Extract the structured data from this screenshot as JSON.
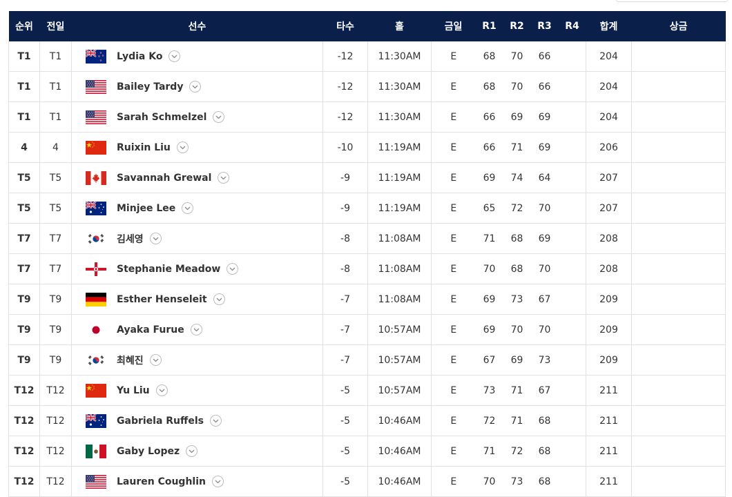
{
  "header": {
    "rank": "순위",
    "prev": "전일",
    "player": "선수",
    "score": "타수",
    "hole": "홀",
    "today": "금일",
    "r1": "R1",
    "r2": "R2",
    "r3": "R3",
    "r4": "R4",
    "total": "합계",
    "prize": "상금"
  },
  "rows": [
    {
      "pos": "T1",
      "prev": "T1",
      "flag": "nz-flag-icon",
      "name": "Lydia Ko",
      "score": "-12",
      "hole": "11:30AM",
      "today": "E",
      "r1": "68",
      "r2": "70",
      "r3": "66",
      "r4": "",
      "total": "204",
      "prize": ""
    },
    {
      "pos": "T1",
      "prev": "T1",
      "flag": "us-flag-icon",
      "name": "Bailey Tardy",
      "score": "-12",
      "hole": "11:30AM",
      "today": "E",
      "r1": "68",
      "r2": "70",
      "r3": "66",
      "r4": "",
      "total": "204",
      "prize": ""
    },
    {
      "pos": "T1",
      "prev": "T1",
      "flag": "us-flag-icon",
      "name": "Sarah Schmelzel",
      "score": "-12",
      "hole": "11:30AM",
      "today": "E",
      "r1": "66",
      "r2": "69",
      "r3": "69",
      "r4": "",
      "total": "204",
      "prize": ""
    },
    {
      "pos": "4",
      "prev": "4",
      "flag": "cn-flag-icon",
      "name": "Ruixin Liu",
      "score": "-10",
      "hole": "11:19AM",
      "today": "E",
      "r1": "66",
      "r2": "71",
      "r3": "69",
      "r4": "",
      "total": "206",
      "prize": ""
    },
    {
      "pos": "T5",
      "prev": "T5",
      "flag": "ca-flag-icon",
      "name": "Savannah Grewal",
      "score": "-9",
      "hole": "11:19AM",
      "today": "E",
      "r1": "69",
      "r2": "74",
      "r3": "64",
      "r4": "",
      "total": "207",
      "prize": ""
    },
    {
      "pos": "T5",
      "prev": "T5",
      "flag": "au-flag-icon",
      "name": "Minjee Lee",
      "score": "-9",
      "hole": "11:19AM",
      "today": "E",
      "r1": "65",
      "r2": "72",
      "r3": "70",
      "r4": "",
      "total": "207",
      "prize": ""
    },
    {
      "pos": "T7",
      "prev": "T7",
      "flag": "kr-flag-icon",
      "name": "김세영",
      "score": "-8",
      "hole": "11:08AM",
      "today": "E",
      "r1": "71",
      "r2": "68",
      "r3": "69",
      "r4": "",
      "total": "208",
      "prize": ""
    },
    {
      "pos": "T7",
      "prev": "T7",
      "flag": "nir-flag-icon",
      "name": "Stephanie Meadow",
      "score": "-8",
      "hole": "11:08AM",
      "today": "E",
      "r1": "70",
      "r2": "68",
      "r3": "70",
      "r4": "",
      "total": "208",
      "prize": ""
    },
    {
      "pos": "T9",
      "prev": "T9",
      "flag": "de-flag-icon",
      "name": "Esther Henseleit",
      "score": "-7",
      "hole": "11:08AM",
      "today": "E",
      "r1": "69",
      "r2": "73",
      "r3": "67",
      "r4": "",
      "total": "209",
      "prize": ""
    },
    {
      "pos": "T9",
      "prev": "T9",
      "flag": "jp-flag-icon",
      "name": "Ayaka Furue",
      "score": "-7",
      "hole": "10:57AM",
      "today": "E",
      "r1": "69",
      "r2": "70",
      "r3": "70",
      "r4": "",
      "total": "209",
      "prize": ""
    },
    {
      "pos": "T9",
      "prev": "T9",
      "flag": "kr-flag-icon",
      "name": "최혜진",
      "score": "-7",
      "hole": "10:57AM",
      "today": "E",
      "r1": "67",
      "r2": "69",
      "r3": "73",
      "r4": "",
      "total": "209",
      "prize": ""
    },
    {
      "pos": "T12",
      "prev": "T12",
      "flag": "cn-flag-icon",
      "name": "Yu Liu",
      "score": "-5",
      "hole": "10:57AM",
      "today": "E",
      "r1": "73",
      "r2": "71",
      "r3": "67",
      "r4": "",
      "total": "211",
      "prize": ""
    },
    {
      "pos": "T12",
      "prev": "T12",
      "flag": "au-flag-icon",
      "name": "Gabriela Ruffels",
      "score": "-5",
      "hole": "10:46AM",
      "today": "E",
      "r1": "72",
      "r2": "71",
      "r3": "68",
      "r4": "",
      "total": "211",
      "prize": ""
    },
    {
      "pos": "T12",
      "prev": "T12",
      "flag": "mx-flag-icon",
      "name": "Gaby Lopez",
      "score": "-5",
      "hole": "10:46AM",
      "today": "E",
      "r1": "71",
      "r2": "72",
      "r3": "68",
      "r4": "",
      "total": "211",
      "prize": ""
    },
    {
      "pos": "T12",
      "prev": "T12",
      "flag": "us-flag-icon",
      "name": "Lauren Coughlin",
      "score": "-5",
      "hole": "10:46AM",
      "today": "E",
      "r1": "70",
      "r2": "73",
      "r3": "68",
      "r4": "",
      "total": "211",
      "prize": ""
    }
  ]
}
